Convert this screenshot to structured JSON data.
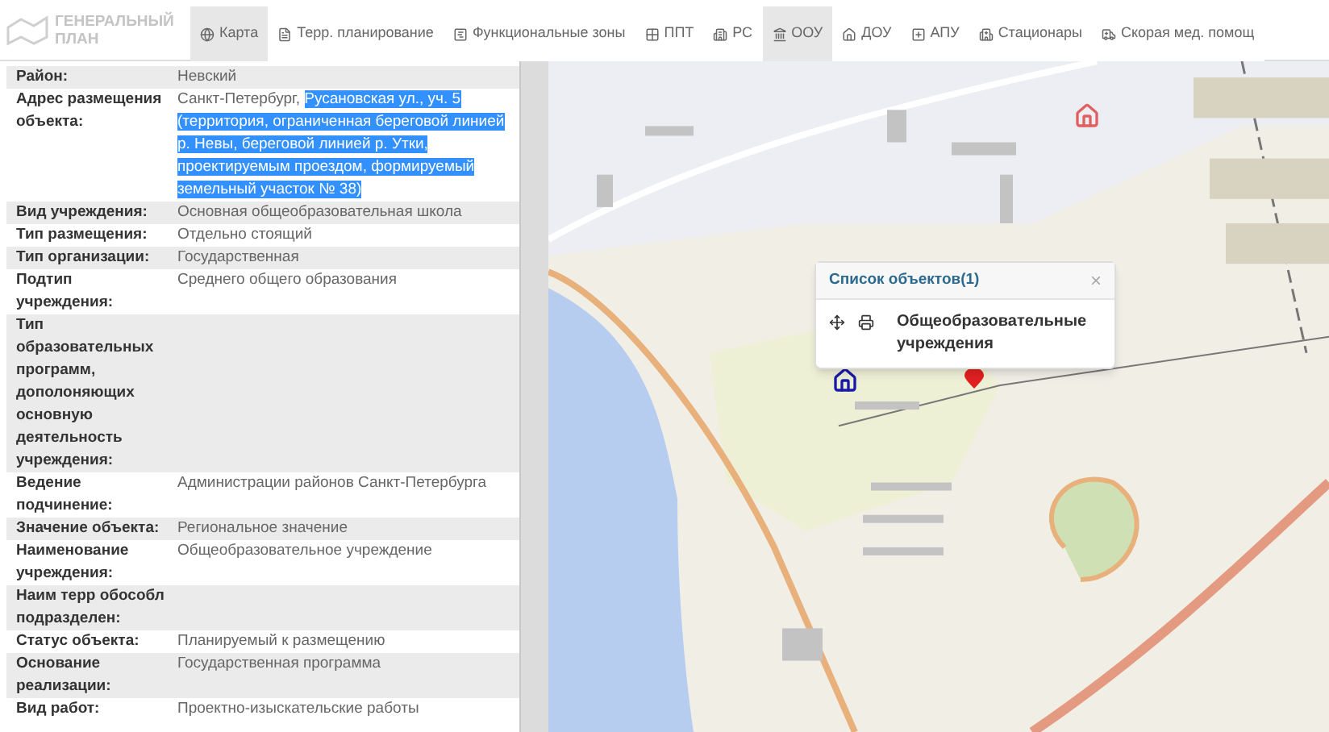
{
  "logo": {
    "line_1": "ГЕНЕРАЛЬНЫЙ",
    "line_2": "ПЛАН"
  },
  "tabs": [
    {
      "label": "Карта",
      "selected": true
    },
    {
      "label": "Терр. планирование",
      "selected": false
    },
    {
      "label": "Функциональные зоны",
      "selected": false
    },
    {
      "label": "ППТ",
      "selected": false
    },
    {
      "label": "РС",
      "selected": false
    },
    {
      "label": "ООУ",
      "selected": true
    },
    {
      "label": "ДОУ",
      "selected": false
    },
    {
      "label": "АПУ",
      "selected": false
    },
    {
      "label": "Стационары",
      "selected": false
    },
    {
      "label": "Скорая мед. помощ",
      "selected": false
    }
  ],
  "attributes": [
    {
      "label": "Район:",
      "value": "Невский"
    },
    {
      "label": "Адрес размещения объекта:",
      "value": "Санкт-Петербург,",
      "highlighted": "Русановская ул., уч. 5 (территория, ограниченная береговой линией р. Невы, береговой линией р. Утки, проектируемым проездом, формируемый земельный участок № 38)"
    },
    {
      "label": "Вид учреждения:",
      "value": "Основная общеобразовательная школа"
    },
    {
      "label": "Тип размещения:",
      "value": "Отдельно стоящий"
    },
    {
      "label": "Тип организации:",
      "value": "Государственная"
    },
    {
      "label": "Подтип учреждения:",
      "value": "Среднего общего образования"
    },
    {
      "label": "Тип образовательных программ, дополоняющих основную деятельность учреждения:"
    },
    {
      "label": "Ведение подчинение:",
      "value": "Администрации районов Санкт-Петербурга"
    },
    {
      "label": "Значение объекта:",
      "value": "Региональное значение"
    },
    {
      "label": "Наименование учреждения:",
      "value": "Общеобразовательное учреждение"
    },
    {
      "label": "Наим терр обособл подразделен:"
    },
    {
      "label": "Статус объекта:",
      "value": "Планируемый к размещению"
    },
    {
      "label": "Основание реализации:",
      "value": "Государственная программа"
    },
    {
      "label": "Вид работ:",
      "value": "Проектно-изыскательские работы"
    }
  ],
  "popup": {
    "title": "Список объектов(1)",
    "close": "×",
    "item": "Общеобразовательные учреждения"
  },
  "markers": [
    {
      "color": "#e06060",
      "kind": "house"
    },
    {
      "color": "#1a1aa8",
      "kind": "house"
    },
    {
      "color": "#e02020",
      "kind": "pin"
    }
  ]
}
